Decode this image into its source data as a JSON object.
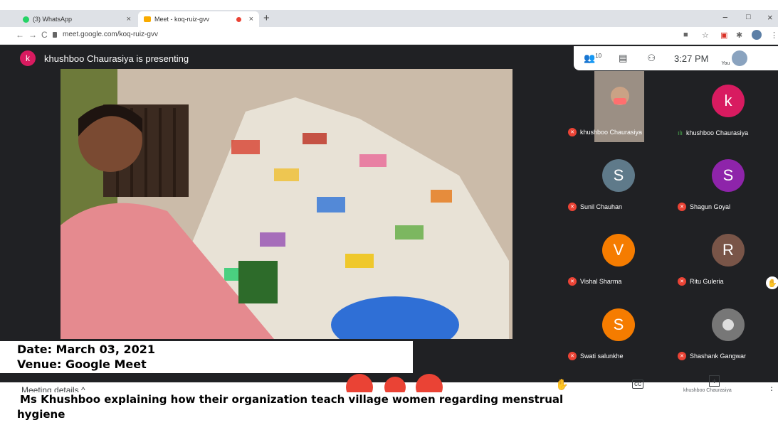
{
  "browser": {
    "tabs": [
      {
        "label": "(3) WhatsApp"
      },
      {
        "label": "Meet - koq-ruiz-gvv"
      }
    ],
    "new_tab": "+",
    "url": "meet.google.com/koq-ruiz-gvv",
    "window_controls": {
      "minimize": "−",
      "maximize": "□",
      "close": "×"
    }
  },
  "meet": {
    "presenter_initial": "k",
    "presenting_text": "khushboo Chaurasiya is presenting",
    "participant_count": "10",
    "time": "3:27 PM",
    "self_label": "You",
    "participants": [
      {
        "name": "khushboo Chaurasiya",
        "initial": "",
        "color": "#8e8e8e",
        "muted": true,
        "video": true
      },
      {
        "name": "khushboo Chaurasiya",
        "initial": "k",
        "color": "#d81b60",
        "muted": false,
        "video": false
      },
      {
        "name": "Sunil Chauhan",
        "initial": "S",
        "color": "#5f7a8a",
        "muted": true
      },
      {
        "name": "Shagun Goyal",
        "initial": "S",
        "color": "#8e24aa",
        "muted": true
      },
      {
        "name": "Vishal Sharma",
        "initial": "V",
        "color": "#f57c00",
        "muted": true
      },
      {
        "name": "Ritu Guleria",
        "initial": "R",
        "color": "#795548",
        "muted": true
      },
      {
        "name": "Swati salunkhe",
        "initial": "S",
        "color": "#f57c00",
        "muted": true
      },
      {
        "name": "Shashank Gangwar",
        "initial": "",
        "color": "#777777",
        "muted": true,
        "avatar_photo": true
      }
    ],
    "meeting_details": "Meeting details",
    "bottom_presenter_label": "khushboo Chaurasiya"
  },
  "caption": {
    "date": "Date: March 03, 2021",
    "venue": "Venue: Google Meet",
    "description_line1": "Ms Khushboo explaining how their organization teach village women regarding menstrual",
    "description_line2": "hygiene"
  }
}
